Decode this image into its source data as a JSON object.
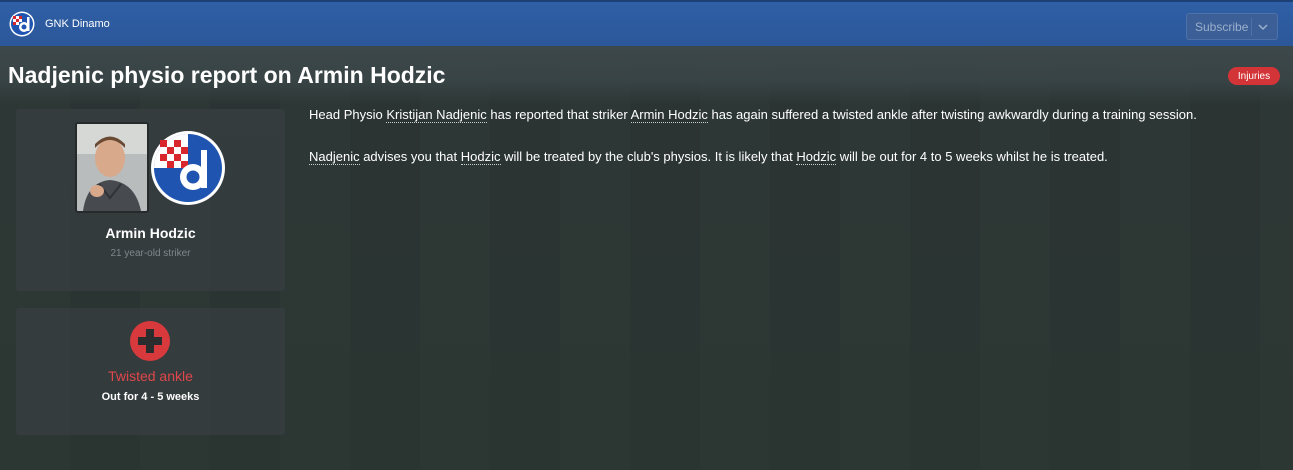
{
  "header": {
    "club_name": "GNK Dinamo",
    "subscribe_label": "Subscribe"
  },
  "page": {
    "title": "Nadjenic physio report on Armin Hodzic",
    "tag": "Injuries"
  },
  "player": {
    "name": "Armin Hodzic",
    "description": "21 year-old striker"
  },
  "injury": {
    "name": "Twisted ankle",
    "duration": "Out for 4 - 5 weeks"
  },
  "body": {
    "p1": {
      "t1": "Head Physio ",
      "link1": "Kristijan Nadjenic",
      "t2": " has reported that striker ",
      "link2": "Armin Hodzic",
      "t3": " has again suffered a twisted ankle after twisting awkwardly during a training session."
    },
    "p2": {
      "link1": "Nadjenic",
      "t1": " advises you that ",
      "link2": "Hodzic",
      "t2": " will be treated by the club's physios. It is likely that ",
      "link3": "Hodzic",
      "t3": " will be out for 4 to 5 weeks whilst he is treated."
    }
  },
  "colors": {
    "header_blue": "#2f5fa6",
    "injury_red": "#e0474b",
    "tag_red": "#d33438"
  },
  "icons": {
    "club_badge": "dinamo-badge-icon",
    "subscribe_chevron": "chevron-down-icon",
    "injury": "medical-cross-icon"
  }
}
